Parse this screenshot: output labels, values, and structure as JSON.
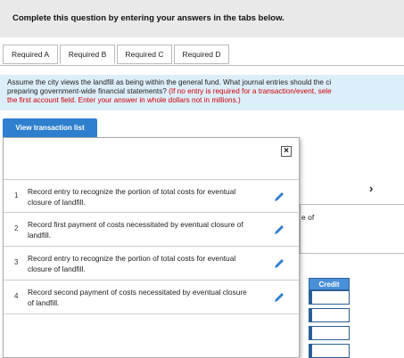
{
  "header": {
    "title": "Complete this question by entering your answers in the tabs below."
  },
  "tabs": [
    {
      "label": "Required A",
      "active": false
    },
    {
      "label": "Required B",
      "active": true
    },
    {
      "label": "Required C",
      "active": false
    },
    {
      "label": "Required D",
      "active": false
    }
  ],
  "instructions": {
    "line1": "Assume the city views the landfill as being within the general fund. What journal entries should the ci",
    "line2_black": "preparing government-wide financial statements?",
    "line2_red": " (If no entry is required for a transaction/event, sele",
    "line3": "the first account field. Enter your answer in whole dollars not in millions.)"
  },
  "view_button": {
    "label": "View transaction list"
  },
  "background": {
    "chevron": "›",
    "partial_text": "e of",
    "credit_header": "Credit"
  },
  "panel": {
    "close_label": "×",
    "transactions": [
      {
        "num": "1",
        "text": "Record entry to recognize the portion of total costs for eventual closure of landfill."
      },
      {
        "num": "2",
        "text": "Record first payment of costs necessitated by eventual closure of landfill."
      },
      {
        "num": "3",
        "text": "Record entry to recognize the portion of total costs for eventual closure of landfill."
      },
      {
        "num": "4",
        "text": "Record second payment of costs necessitated by eventual closure of landfill."
      }
    ]
  },
  "colors": {
    "accent": "#2f7fcf",
    "instruction_bg": "#ddeefb",
    "warning": "#cc0000",
    "pencil": "#2f7fcf"
  },
  "icons": {
    "edit": "pencil-icon",
    "close": "close-icon",
    "chevron": "chevron-right-icon"
  }
}
